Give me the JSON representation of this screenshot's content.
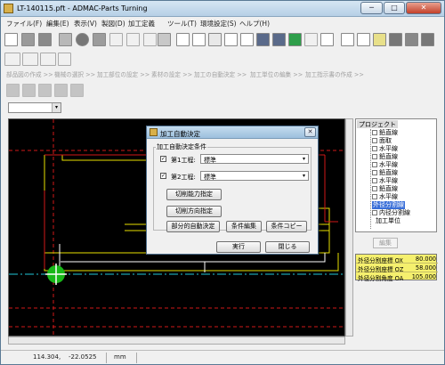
{
  "window": {
    "title": "LT-140115.pft - ADMAC-Parts Turning",
    "minimize_label": "─",
    "maximize_label": "□",
    "close_label": "✕"
  },
  "menu": [
    "ファイル(F)",
    "編集(E)",
    "表示(V)",
    "製図(D)",
    "加工定義",
    "ツール(T)",
    "環境設定(S)",
    "ヘルプ(H)"
  ],
  "process_steps": [
    "部品図の作成 >>",
    "機械の選択 >>",
    "加工部位の設定 >>",
    "素材の設定 >>",
    "加工の自動決定 >>",
    "加工単位の編集 >>",
    "加工指示書の作成 >>"
  ],
  "layer_combo": {
    "value": "",
    "arrow": "▾"
  },
  "status": {
    "x": "114.304,",
    "y": "-22.0525",
    "unit": "mm"
  },
  "tree": {
    "root": "プロジェクト",
    "items": [
      {
        "label": "面取",
        "selected": false
      },
      {
        "label": "水平線",
        "selected": false
      },
      {
        "label": "鉛直線",
        "selected": false
      },
      {
        "label": "水平線",
        "selected": false
      },
      {
        "label": "鉛直線",
        "selected": false
      },
      {
        "label": "水平線",
        "selected": false
      },
      {
        "label": "鉛直線",
        "selected": false
      },
      {
        "label": "水平線",
        "selected": false
      },
      {
        "label": "外径分割線",
        "selected": true
      },
      {
        "label": "内径分割線",
        "selected": false
      },
      {
        "label": "加工単位",
        "selected": false
      }
    ],
    "top_partial": "鉛直線",
    "edit_button": "編集"
  },
  "params": [
    {
      "key": "外径分割座標 OX",
      "value": "80.000"
    },
    {
      "key": "外径分割座標 OZ",
      "value": "58.000"
    },
    {
      "key": "外径分割角度 OA",
      "value": "105.000"
    }
  ],
  "dialog": {
    "title": "加工自動決定",
    "close_label": "✕",
    "group_label": "加工自動決定条件",
    "process1": {
      "checked": true,
      "label": "第1工程:",
      "value": "標準"
    },
    "process2": {
      "checked": true,
      "label": "第2工程:",
      "value": "標準"
    },
    "check_mark": "✓",
    "select_arrow": "▾",
    "btn_cut_capacity": "切削能力指定",
    "btn_cut_direction": "切削方向指定",
    "btn_partial_auto": "部分的自動決定",
    "btn_edit_conditions": "条件編集",
    "btn_copy_conditions": "条件コピー",
    "btn_run": "実行",
    "btn_close": "閉じる"
  },
  "colors": {
    "canvas_bg": "#000000",
    "axis_red": "#d01818",
    "outline_yellow": "#e8e000",
    "centerline_cyan": "#20c8d8",
    "origin_green": "#18b818"
  }
}
